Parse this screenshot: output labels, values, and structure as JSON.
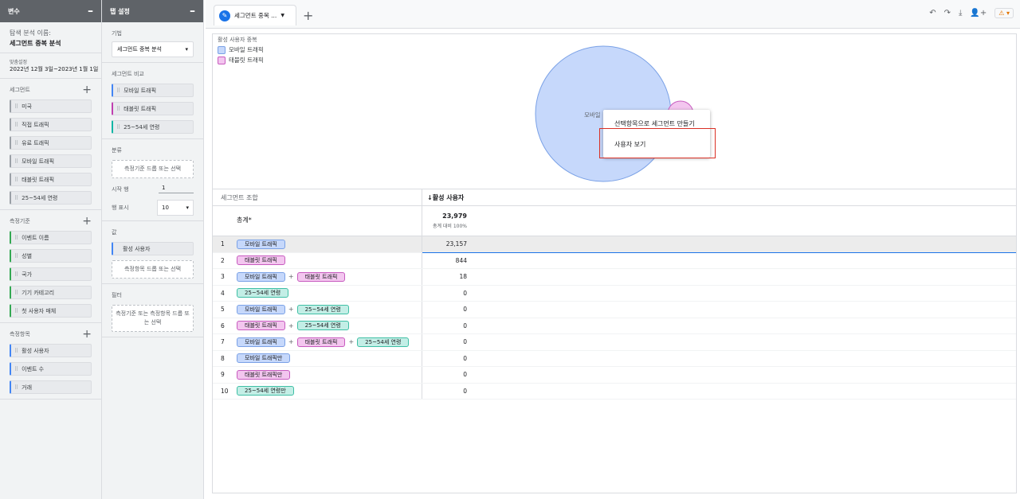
{
  "vars_panel": {
    "header": "변수",
    "analysis_name_label": "탐색 분석 이름:",
    "analysis_name": "세그먼트 중복 분석",
    "date_label": "맞춤설정",
    "date_range": "2022년 12월 3일~2023년 1월 1일",
    "segments_title": "세그먼트",
    "segments": [
      "미국",
      "직접 트래픽",
      "유료 트래픽",
      "모바일 트래픽",
      "태블릿 트래픽",
      "25~54세 연령"
    ],
    "dimensions_title": "측정기준",
    "dimensions": [
      "이벤트 이름",
      "성별",
      "국가",
      "기기 카테고리",
      "첫 사용자 매체"
    ],
    "metrics_title": "측정항목",
    "metrics": [
      "활성 사용자",
      "이벤트 수",
      "거래"
    ]
  },
  "tab_settings": {
    "header": "탭 설정",
    "technique_label": "기법",
    "technique_value": "세그먼트 중복 분석",
    "segment_compare_label": "세그먼트 비교",
    "segment_compare": [
      "모바일 트래픽",
      "태블릿 트래픽",
      "25~54세 연령"
    ],
    "breakdown_label": "분류",
    "breakdown_drop": "측정기준 드롭 또는 선택",
    "start_row_label": "시작 행",
    "start_row_value": "1",
    "show_rows_label": "행 표시",
    "show_rows_value": "10",
    "values_label": "값",
    "values_metric": "활성 사용자",
    "values_drop": "측정항목 드롭 또는 선택",
    "filter_label": "필터",
    "filter_drop": "측정기준 또는 측정항목 드롭 또는 선택"
  },
  "topbar": {
    "tab_label": "세그먼트 중복 ...",
    "add_tab": "+",
    "icons": [
      "undo-icon",
      "redo-icon",
      "download-icon",
      "share-user-icon",
      "warning-icon"
    ]
  },
  "chart": {
    "legend_title": "활성 사용자 중복",
    "legend": [
      {
        "label": "모바일 트래픽",
        "color": "#c6d8fb"
      },
      {
        "label": "태블릿 트래픽",
        "color": "#f3c6ef"
      }
    ],
    "circle_label": "모바일",
    "context_menu": [
      "선택항목으로 세그먼트 만들기",
      "사용자 보기"
    ]
  },
  "table": {
    "col_segments": "세그먼트 조합",
    "col_metric": "↓활성 사용자",
    "total_label": "총계*",
    "total_value": "23,979",
    "total_sub": "총계 대비 100%",
    "rows": [
      {
        "n": "1",
        "segs": [
          [
            "모바일 트래픽",
            "blue"
          ]
        ],
        "value": "23,157"
      },
      {
        "n": "2",
        "segs": [
          [
            "태블릿 트래픽",
            "pink"
          ]
        ],
        "value": "844"
      },
      {
        "n": "3",
        "segs": [
          [
            "모바일 트래픽",
            "blue"
          ],
          [
            "태블릿 트래픽",
            "pink"
          ]
        ],
        "value": "18"
      },
      {
        "n": "4",
        "segs": [
          [
            "25~54세 연령",
            "teal"
          ]
        ],
        "value": "0"
      },
      {
        "n": "5",
        "segs": [
          [
            "모바일 트래픽",
            "blue"
          ],
          [
            "25~54세 연령",
            "teal"
          ]
        ],
        "value": "0"
      },
      {
        "n": "6",
        "segs": [
          [
            "태블릿 트래픽",
            "pink"
          ],
          [
            "25~54세 연령",
            "teal"
          ]
        ],
        "value": "0"
      },
      {
        "n": "7",
        "segs": [
          [
            "모바일 트래픽",
            "blue"
          ],
          [
            "태블릿 트래픽",
            "pink"
          ],
          [
            "25~54세 연령",
            "teal"
          ]
        ],
        "value": "0"
      },
      {
        "n": "8",
        "segs": [
          [
            "모바일 트래픽만",
            "blue"
          ]
        ],
        "value": "0"
      },
      {
        "n": "9",
        "segs": [
          [
            "태블릿 트래픽만",
            "pink"
          ]
        ],
        "value": "0"
      },
      {
        "n": "10",
        "segs": [
          [
            "25~54세 연령만",
            "teal"
          ]
        ],
        "value": "0"
      }
    ]
  },
  "colors": {
    "accent": "#1a73e8",
    "highlight_box": "#d93025"
  }
}
